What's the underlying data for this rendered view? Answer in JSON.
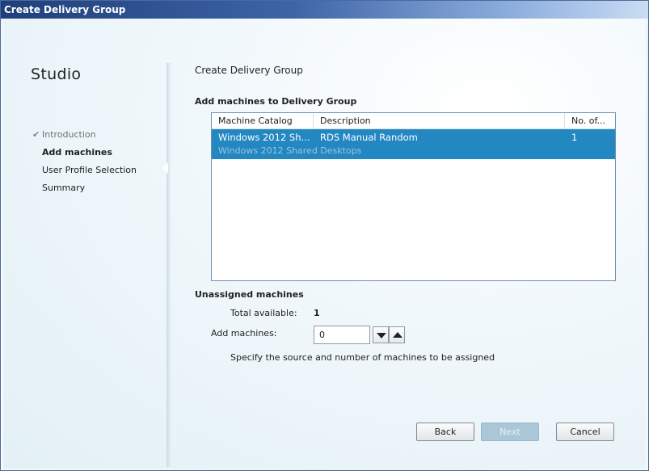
{
  "window": {
    "title": "Create Delivery Group"
  },
  "sidebar": {
    "app_name": "Studio",
    "steps": [
      {
        "label": "Introduction",
        "state": "done",
        "icon": "check-icon"
      },
      {
        "label": "Add machines",
        "state": "active"
      },
      {
        "label": "User Profile Selection",
        "state": "pending"
      },
      {
        "label": "Summary",
        "state": "pending"
      }
    ]
  },
  "main": {
    "page_title": "Create Delivery Group",
    "section_title": "Add machines to Delivery Group",
    "catalog_table": {
      "columns": [
        "Machine Catalog",
        "Description",
        "No. of..."
      ],
      "rows": [
        {
          "machine_catalog": "Windows 2012 Sh...",
          "description": "RDS Manual Random",
          "count": "1",
          "subtitle": "Windows 2012 Shared Desktops",
          "selected": true
        }
      ]
    },
    "unassigned": {
      "title": "Unassigned machines",
      "total_label": "Total available:",
      "total_value": "1",
      "add_label": "Add machines:",
      "add_value": "0",
      "hint": "Specify the source and number of machines to be assigned"
    }
  },
  "footer": {
    "back_label": "Back",
    "next_label": "Next",
    "cancel_label": "Cancel"
  },
  "colors": {
    "selection": "#2387c2",
    "titlebar": "#1f3f7a",
    "disabled_button": "#a9c7d9"
  }
}
